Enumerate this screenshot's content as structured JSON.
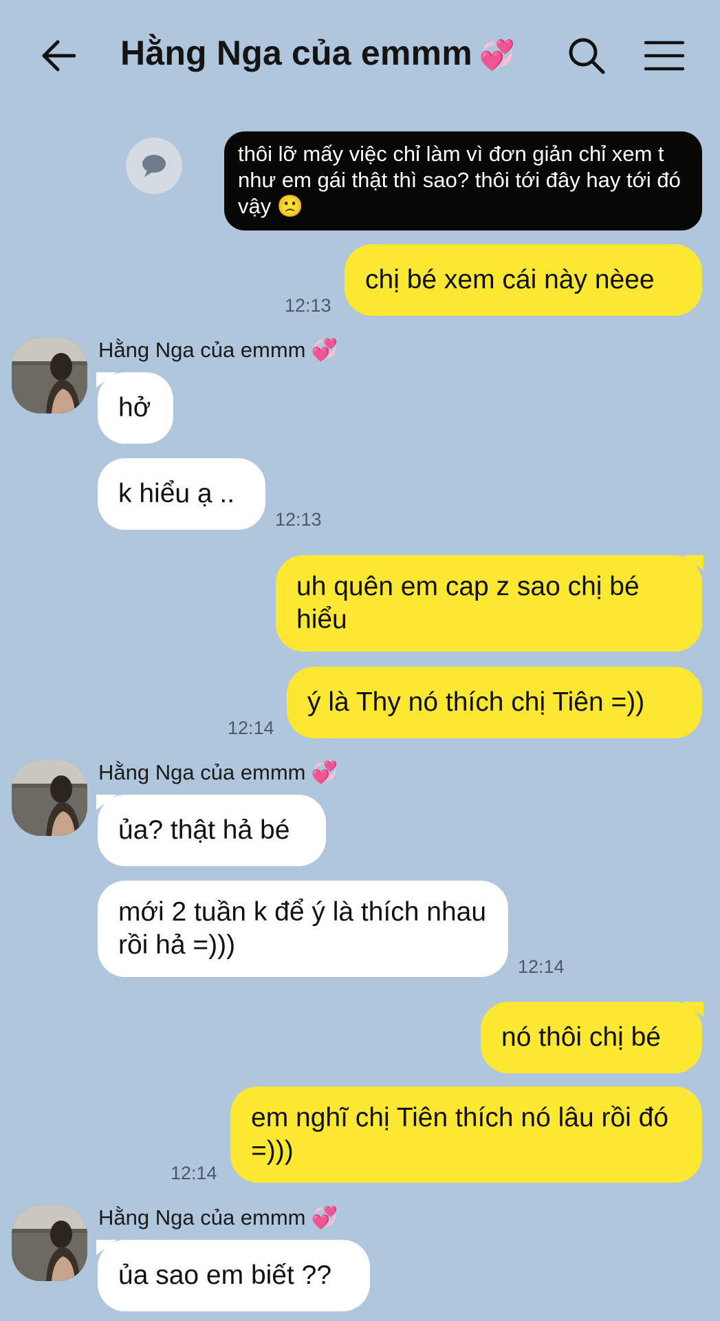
{
  "header": {
    "title": "Hằng Nga của emmm",
    "title_emoji": "💞",
    "icons": [
      "back-arrow-icon",
      "search-icon",
      "menu-icon"
    ]
  },
  "chat": {
    "contact_name": "Hằng Nga của emmm",
    "contact_emoji": "💞",
    "messages": [
      {
        "from": "me",
        "type": "reply",
        "text": "thôi lỡ mấy việc chỉ làm vì đơn giản chỉ xem t như em gái thật thì sao? thôi tới đây hay tới đó vậy 🙁"
      },
      {
        "from": "me",
        "text": "chị bé xem cái này nèee",
        "time": "12:13"
      },
      {
        "from": "them",
        "text": "hở"
      },
      {
        "from": "them",
        "text": "k hiểu ạ ..",
        "time": "12:13"
      },
      {
        "from": "me",
        "text": "uh quên em cap z sao chị bé hiểu"
      },
      {
        "from": "me",
        "text": "ý là Thy nó thích chị Tiên =))",
        "time": "12:14"
      },
      {
        "from": "them",
        "text": "ủa? thật hả bé"
      },
      {
        "from": "them",
        "text": "mới 2 tuần k để ý là thích nhau rồi hả =)))",
        "time": "12:14"
      },
      {
        "from": "me",
        "text": "nó thôi chị bé"
      },
      {
        "from": "me",
        "text": "em nghĩ chị Tiên thích nó lâu rồi đó =)))",
        "time": "12:14"
      },
      {
        "from": "them",
        "text": "ủa sao em biết ??"
      }
    ]
  },
  "colors": {
    "background": "#b0c6dc",
    "my_bubble": "#fce733",
    "their_bubble": "#ffffff",
    "reply_bubble": "#070707"
  }
}
